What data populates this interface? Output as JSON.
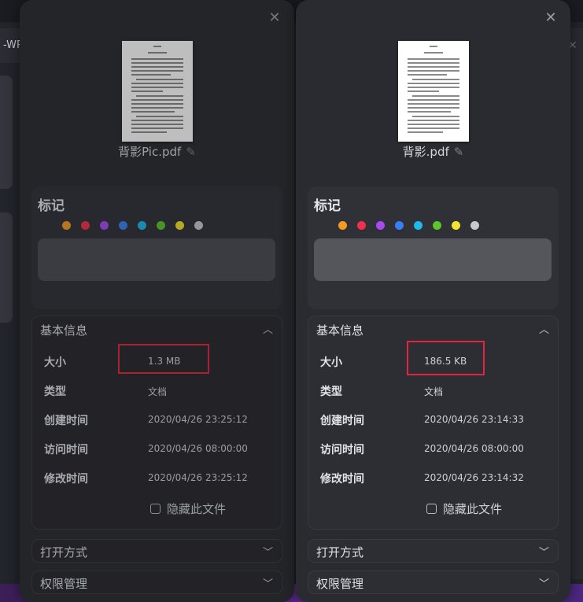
{
  "background": {
    "app_title": "-WPS"
  },
  "left_dialog": {
    "filename": "背影Pic.pdf",
    "tags_title": "标记",
    "info": {
      "header": "基本信息",
      "size_label": "大小",
      "size_value": "1.3 MB",
      "type_label": "类型",
      "type_value": "文档",
      "created_label": "创建时间",
      "created_value": "2020/04/26 23:25:12",
      "accessed_label": "访问时间",
      "accessed_value": "2020/04/26 08:00:00",
      "modified_label": "修改时间",
      "modified_value": "2020/04/26 23:25:12",
      "hide_label": "隐藏此文件"
    },
    "open_with": "打开方式",
    "permissions": "权限管理"
  },
  "right_dialog": {
    "filename": "背影.pdf",
    "tags_title": "标记",
    "info": {
      "header": "基本信息",
      "size_label": "大小",
      "size_value": "186.5 KB",
      "type_label": "类型",
      "type_value": "文档",
      "created_label": "创建时间",
      "created_value": "2020/04/26 23:14:33",
      "accessed_label": "访问时间",
      "accessed_value": "2020/04/26 08:00:00",
      "modified_label": "修改时间",
      "modified_value": "2020/04/26 23:14:32",
      "hide_label": "隐藏此文件"
    },
    "open_with": "打开方式",
    "permissions": "权限管理"
  },
  "tag_colors": [
    "#f59a23",
    "#f1304d",
    "#a54bf0",
    "#3a7ef7",
    "#1fb8e8",
    "#5cc72b",
    "#f3e22f",
    "#c9cacd"
  ],
  "highlight_color": "#e3263f"
}
